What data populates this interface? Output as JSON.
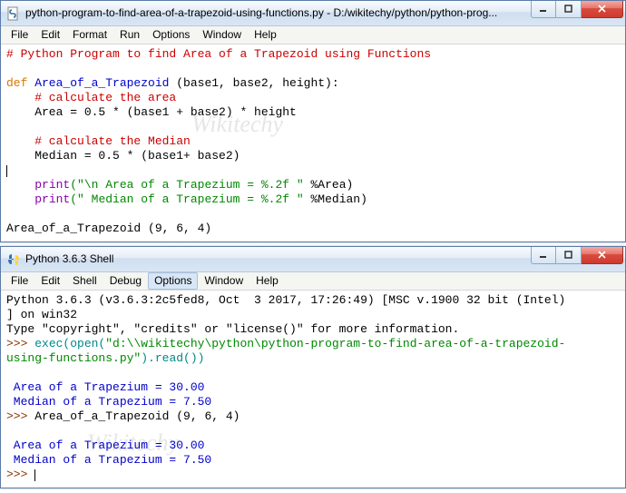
{
  "editor": {
    "title": "python-program-to-find-area-of-a-trapezoid-using-functions.py - D:/wikitechy/python/python-prog...",
    "menu": [
      "File",
      "Edit",
      "Format",
      "Run",
      "Options",
      "Window",
      "Help"
    ],
    "code": {
      "l1": "# Python Program to find Area of a Trapezoid using Functions",
      "l2_def": "def",
      "l2_name": " Area_of_a_Trapezoid ",
      "l2_params": "(base1, base2, height):",
      "l3": "    # calculate the area",
      "l4": "    Area = 0.5 * (base1 + base2) * height",
      "l5": "    # calculate the Median",
      "l6": "    Median = 0.5 * (base1+ base2)",
      "l7_print": "print",
      "l7_str": "(\"\\n Area of a Trapezium = %.2f \"",
      "l7_tail": " %Area)",
      "l8_print": "print",
      "l8_str": "(\" Median of a Trapezium = %.2f \"",
      "l8_tail": " %Median)",
      "l9": "Area_of_a_Trapezoid (9, 6, 4)"
    }
  },
  "shell": {
    "title": "Python 3.6.3 Shell",
    "menu": [
      "File",
      "Edit",
      "Shell",
      "Debug",
      "Options",
      "Window",
      "Help"
    ],
    "out": {
      "banner1": "Python 3.6.3 (v3.6.3:2c5fed8, Oct  3 2017, 17:26:49) [MSC v.1900 32 bit (Intel)",
      "banner2": "] on win32",
      "banner3": "Type \"copyright\", \"credits\" or \"license()\" for more information.",
      "prompt": ">>> ",
      "exec1": "exec(open(",
      "exec_str": "\"d:\\\\wikitechy\\python\\python-program-to-find-area-of-a-trapezoid-",
      "exec_str2": "using-functions.py\"",
      "exec2": ").read())",
      "res1": " Area of a Trapezium = 30.00",
      "res2": " Median of a Trapezium = 7.50",
      "call": "Area_of_a_Trapezoid (9, 6, 4)",
      "res3": " Area of a Trapezium = 30.00",
      "res4": " Median of a Trapezium = 7.50"
    }
  },
  "watermark": "Wikitechy"
}
